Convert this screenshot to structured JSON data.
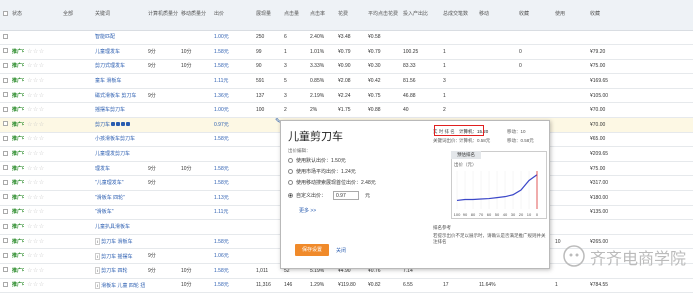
{
  "headers": [
    "状态",
    "",
    "全部",
    "关键词",
    "计算机质量分",
    "移动质量分",
    "出价",
    "展现量",
    "点击量",
    "点击率",
    "花费",
    "平均点击花费",
    "投入产出比",
    "总成交笔数",
    "移动",
    "收藏",
    "使用",
    "收藏"
  ],
  "rows": [
    {
      "status": "",
      "stars": "",
      "kw": "智能匹配",
      "tags": [],
      "q1": "",
      "q2": "",
      "bid": "1.00元",
      "imp": "250",
      "clk": "6",
      "ctr": "2.40%",
      "cost": "¥3.48",
      "cpc": "¥0.58",
      "roi": "",
      "orders": "",
      "m": "",
      "f": "",
      "u": "",
      "c": ""
    },
    {
      "status": "推广中",
      "stars": "☆☆☆",
      "kw": "儿童理发车",
      "tags": [],
      "q1": "9分",
      "q2": "10分",
      "bid": "1.58元",
      "imp": "99",
      "clk": "1",
      "ctr": "1.01%",
      "cost": "¥0.79",
      "cpc": "¥0.79",
      "roi": "100.25",
      "orders": "1",
      "m": "",
      "f": "0",
      "u": "",
      "c": "¥79.20"
    },
    {
      "status": "推广中",
      "stars": "☆☆☆",
      "kw": "剪刀式理发车",
      "tags": [],
      "q1": "9分",
      "q2": "10分",
      "bid": "1.58元",
      "imp": "90",
      "clk": "3",
      "ctr": "3.33%",
      "cost": "¥0.90",
      "cpc": "¥0.30",
      "roi": "83.33",
      "orders": "1",
      "m": "",
      "f": "0",
      "u": "",
      "c": "¥75.00"
    },
    {
      "status": "推广中",
      "stars": "☆☆☆",
      "kw": "童车 滑板车",
      "tags": [],
      "q1": "",
      "q2": "",
      "bid": "1.11元",
      "imp": "591",
      "clk": "5",
      "ctr": "0.85%",
      "cost": "¥2.08",
      "cpc": "¥0.42",
      "roi": "81.56",
      "orders": "3",
      "m": "",
      "f": "",
      "u": "",
      "c": "¥169.65"
    },
    {
      "status": "推广中",
      "stars": "☆☆☆",
      "kw": "磁式滑板车 剪刀车",
      "tags": [],
      "q1": "9分",
      "q2": "",
      "bid": "1.36元",
      "imp": "137",
      "clk": "3",
      "ctr": "2.19%",
      "cost": "¥2.24",
      "cpc": "¥0.75",
      "roi": "46.88",
      "orders": "1",
      "m": "",
      "f": "",
      "u": "",
      "c": "¥105.00"
    },
    {
      "status": "推广中",
      "stars": "☆☆☆",
      "kw": "摇摆车剪刀车",
      "tags": [],
      "q1": "",
      "q2": "",
      "bid": "1.00元",
      "imp": "100",
      "clk": "2",
      "ctr": "2%",
      "cost": "¥1.75",
      "cpc": "¥0.88",
      "roi": "40",
      "orders": "2",
      "m": "",
      "f": "",
      "u": "",
      "c": "¥70.00"
    },
    {
      "status": "推广中",
      "stars": "☆☆☆",
      "kw": "剪刀车",
      "tags": [],
      "q1": "",
      "q2": "",
      "bid": "0.97元",
      "imp": "",
      "clk": "",
      "ctr": "",
      "cost": "",
      "cpc": "",
      "roi": "",
      "orders": "",
      "m": "1",
      "f": "",
      "u": "",
      "c": "¥70.00"
    },
    {
      "status": "推广中",
      "stars": "☆☆☆",
      "kw": "小孩滑板车剪刀车",
      "tags": [],
      "q1": "",
      "q2": "",
      "bid": "1.58元",
      "imp": "",
      "clk": "",
      "ctr": "",
      "cost": "",
      "cpc": "",
      "roi": "",
      "orders": "",
      "m": "",
      "f": "0",
      "u": "",
      "c": "¥65.00"
    },
    {
      "status": "推广中",
      "stars": "☆☆☆",
      "kw": "儿童理发剪刀车",
      "tags": [],
      "q1": "",
      "q2": "",
      "bid": "",
      "imp": "",
      "clk": "",
      "ctr": "",
      "cost": "",
      "cpc": "",
      "roi": "",
      "orders": "",
      "m": "",
      "f": "7",
      "u": "",
      "c": "¥209.65"
    },
    {
      "status": "推广中",
      "stars": "☆☆☆",
      "kw": "理发车",
      "tags": [],
      "q1": "9分",
      "q2": "10分",
      "bid": "1.58元",
      "imp": "",
      "clk": "",
      "ctr": "",
      "cost": "",
      "cpc": "",
      "roi": "",
      "orders": "",
      "m": "",
      "f": "1",
      "u": "",
      "c": "¥75.00"
    },
    {
      "status": "推广中",
      "stars": "☆☆☆",
      "kw": "\"儿童理发车\"",
      "tags": [],
      "q1": "9分",
      "q2": "",
      "bid": "1.58元",
      "imp": "",
      "clk": "",
      "ctr": "",
      "cost": "",
      "cpc": "",
      "roi": "",
      "orders": "",
      "m": "",
      "f": "7",
      "u": "",
      "c": "¥317.00"
    },
    {
      "status": "推广中",
      "stars": "☆☆☆",
      "kw": "\"滑板车 四轮\"",
      "tags": [],
      "q1": "",
      "q2": "",
      "bid": "1.13元",
      "imp": "",
      "clk": "",
      "ctr": "",
      "cost": "",
      "cpc": "",
      "roi": "",
      "orders": "",
      "m": "",
      "f": "5",
      "u": "",
      "c": "¥180.00"
    },
    {
      "status": "推广中",
      "stars": "☆☆☆",
      "kw": "\"滑板车\"",
      "tags": [],
      "q1": "",
      "q2": "",
      "bid": "1.11元",
      "imp": "",
      "clk": "",
      "ctr": "",
      "cost": "",
      "cpc": "",
      "roi": "",
      "orders": "",
      "m": "",
      "f": "",
      "u": "",
      "c": "¥135.00"
    },
    {
      "status": "推广中",
      "stars": "☆☆☆",
      "kw": "儿童扒具滑板车",
      "tags": [],
      "q1": "",
      "q2": "",
      "bid": "",
      "imp": "",
      "clk": "",
      "ctr": "",
      "cost": "",
      "cpc": "",
      "roi": "",
      "orders": "",
      "m": "",
      "f": "",
      "u": "",
      "c": ""
    },
    {
      "status": "推广中",
      "stars": "☆☆☆",
      "kw": "剪刀车 滑板车",
      "tags": [
        "I"
      ],
      "q1": "",
      "q2": "",
      "bid": "1.58元",
      "imp": "",
      "clk": "",
      "ctr": "",
      "cost": "",
      "cpc": "",
      "roi": "",
      "orders": "",
      "m": "5.22%",
      "f": "5",
      "u": "10",
      "c": "¥265.00"
    },
    {
      "status": "推广中",
      "stars": "☆☆☆",
      "kw": "剪刀车 摇摆车",
      "tags": [
        "I"
      ],
      "q1": "9分",
      "q2": "",
      "bid": "1.06元",
      "imp": "",
      "clk": "",
      "ctr": "",
      "cost": "",
      "cpc": "",
      "roi": "",
      "orders": "",
      "m": "",
      "f": "",
      "u": "",
      "c": ""
    },
    {
      "status": "推广中",
      "stars": "☆☆☆",
      "kw": "剪刀车 四轮",
      "tags": [
        "I"
      ],
      "q1": "9分",
      "q2": "10分",
      "bid": "1.58元",
      "imp": "1,011",
      "clk": "52",
      "ctr": "5.19%",
      "cost": "¥4.90",
      "cpc": "¥0.76",
      "roi": "7.14",
      "orders": "",
      "m": "",
      "f": "",
      "u": "",
      "c": ""
    },
    {
      "status": "推广中",
      "stars": "☆☆☆",
      "kw": "滑板车 儿童 四轮 扭式",
      "tags": [
        "I"
      ],
      "q1": "",
      "q2": "10分",
      "bid": "1.58元",
      "imp": "11,316",
      "clk": "146",
      "ctr": "1.29%",
      "cost": "¥119.80",
      "cpc": "¥0.82",
      "roi": "6.55",
      "orders": "17",
      "m": "11.64%",
      "f": "",
      "u": "1",
      "c": "¥784.55"
    }
  ],
  "popup": {
    "title": "儿童剪刀车",
    "bid_label": "出价编辑：",
    "opt1": "使用默认出价：1.50元",
    "opt2": "使用市场平均出价：1.24元",
    "opt3": "使用移动搜索展现首位出价：2.48元",
    "opt4": "自定义出价：",
    "custom_value": "0.97",
    "unit": "元",
    "more": "更多 >>",
    "save": "保存设置",
    "cancel": "关闭",
    "realtime": "实 时 排 名",
    "pc_rank": "计算机：15.20",
    "mobile_rank": "移动：10",
    "kw_bid": "关键词出价：",
    "pc_bid": "计算机：0.58元",
    "mobile_bid": "移动：0.58元",
    "tab": "预估排名",
    "chart_label": "出价（元）",
    "x_ticks": [
      "100",
      "90",
      "80",
      "70",
      "60",
      "50",
      "40",
      "30",
      "20",
      "10",
      "0"
    ],
    "note_title": "排名参考",
    "note": "若提示出价不足以展示时，请确认是否满足推广规则并关注排名"
  },
  "watermark": "齐齐电商学院",
  "chart_data": {
    "type": "line",
    "x": [
      100,
      90,
      80,
      70,
      60,
      50,
      40,
      30,
      20,
      10,
      0
    ],
    "values": [
      0.9,
      1.0,
      1.0,
      1.05,
      1.1,
      1.2,
      1.3,
      1.5,
      2.0,
      3.0,
      3.6
    ],
    "xlabel": "",
    "ylabel": "出价（元）"
  }
}
